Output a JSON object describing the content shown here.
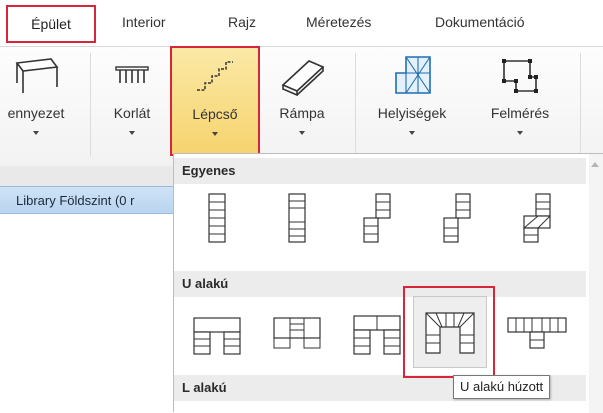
{
  "tabs": [
    {
      "label": "Épület",
      "selected": true
    },
    {
      "label": "Interior"
    },
    {
      "label": "Rajz"
    },
    {
      "label": "Méretezés"
    },
    {
      "label": "Dokumentáció"
    }
  ],
  "ribbon": {
    "buttons": [
      {
        "label": "ennyezet",
        "icon": "ceiling-icon"
      },
      {
        "label": "Korlát",
        "icon": "railing-icon"
      },
      {
        "label": "Lépcső",
        "icon": "stairs-icon",
        "active": true
      },
      {
        "label": "Rámpa",
        "icon": "ramp-icon"
      },
      {
        "label": "Helyiségek",
        "icon": "rooms-icon"
      },
      {
        "label": "Felmérés",
        "icon": "survey-icon"
      }
    ]
  },
  "library_tab": {
    "label": "Library Földszint (0 r"
  },
  "gallery": {
    "sections": [
      {
        "title": "Egyenes"
      },
      {
        "title": "U alakú"
      },
      {
        "title": "L alakú"
      }
    ]
  },
  "tooltip": {
    "text": "U alakú húzott"
  },
  "colors": {
    "highlight": "#d7263a",
    "active_button": "#f6d36e",
    "library_tab": "#c3dbf2"
  }
}
